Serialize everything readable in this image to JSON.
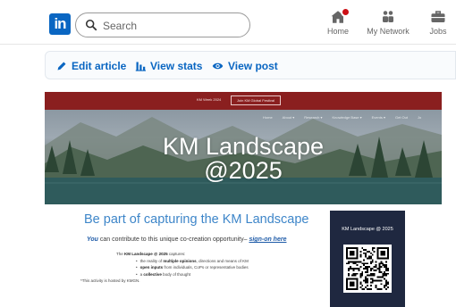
{
  "nav": {
    "search_placeholder": "Search",
    "items": [
      {
        "label": "Home",
        "icon": "home-icon",
        "has_notification": true
      },
      {
        "label": "My Network",
        "icon": "network-icon"
      },
      {
        "label": "Jobs",
        "icon": "briefcase-icon"
      }
    ],
    "brand_color": "#0a66c2",
    "notification_color": "#cc1016"
  },
  "toolbar": {
    "edit_label": "Edit article",
    "stats_label": "View stats",
    "view_label": "View post"
  },
  "banner": {
    "top_text": "KM Week 2024",
    "top_button": "Join KM Global Festival",
    "menu": [
      "Home",
      "About ▾",
      "Research ▾",
      "Knowledge Base ▾",
      "Events ▾",
      "Get Out",
      "Jo"
    ],
    "title_line1": "KM Landscape",
    "title_line2": "@2025",
    "header_color": "#8a1f1f"
  },
  "body": {
    "cta_title": "Be part of capturing the KM Landscape",
    "cta_you": "You",
    "cta_middle": " can contribute to this unique co-creation opportunity– ",
    "cta_link": "sign-on here",
    "lead_pre": "The ",
    "lead_bold": "KM Landscape @ 2025",
    "lead_post": " captures:",
    "bullets": [
      {
        "pre": "the reality of ",
        "bold": "multiple opinions",
        "post": ", directions and means of KM"
      },
      {
        "pre": "",
        "bold": "open inputs",
        "post": " from individuals, CoPs or representative bodies"
      },
      {
        "pre": "a ",
        "bold": "collective",
        "post": " body of thought"
      }
    ],
    "footnote": "*This activity is hosted by KMGN."
  },
  "qr_card": {
    "title": "KM Landscape @ 2025",
    "background": "#1f2840"
  }
}
